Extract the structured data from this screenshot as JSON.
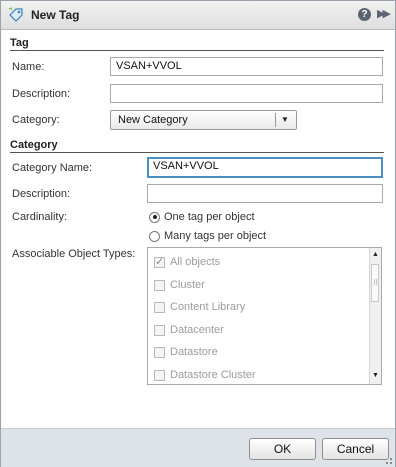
{
  "window": {
    "title": "New Tag",
    "help_icon": "?",
    "expand_icon": "▶▶"
  },
  "tag_section": {
    "heading": "Tag",
    "name_label": "Name:",
    "name_value": "VSAN+VVOL",
    "description_label": "Description:",
    "description_value": "",
    "category_label": "Category:",
    "category_selected": "New Category"
  },
  "category_section": {
    "heading": "Category",
    "category_name_label": "Category Name:",
    "category_name_value": "VSAN+VVOL",
    "description_label": "Description:",
    "description_value": "",
    "cardinality_label": "Cardinality:",
    "cardinality_options": [
      "One tag per object",
      "Many tags per object"
    ],
    "cardinality_selected": "One tag per object",
    "associable_label": "Associable Object Types:",
    "object_types": [
      {
        "label": "All objects",
        "checked": true
      },
      {
        "label": "Cluster",
        "checked": false
      },
      {
        "label": "Content Library",
        "checked": false
      },
      {
        "label": "Datacenter",
        "checked": false
      },
      {
        "label": "Datastore",
        "checked": false
      },
      {
        "label": "Datastore Cluster",
        "checked": false
      }
    ]
  },
  "footer": {
    "ok_label": "OK",
    "cancel_label": "Cancel"
  },
  "colors": {
    "focus_border": "#4a8fc4",
    "footer_bg": "#dde3e8"
  }
}
